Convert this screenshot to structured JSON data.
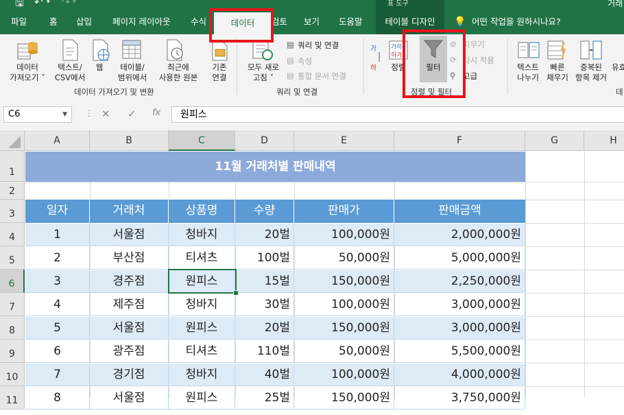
{
  "window": {
    "title_partial": "거래",
    "context_label_partial": "표 도구"
  },
  "tabs": [
    {
      "label": "파일"
    },
    {
      "label": "홈"
    },
    {
      "label": "삽입"
    },
    {
      "label": "페이지 레이아웃"
    },
    {
      "label": "수식"
    },
    {
      "label": "데이터"
    },
    {
      "label": "검토"
    },
    {
      "label": "보기"
    },
    {
      "label": "도움말"
    },
    {
      "label": "테이블 디자인"
    }
  ],
  "tell_me": "어떤 작업을 원하시나요?",
  "ribbon": {
    "get_data": "데이터\n가져오기 ˅",
    "text_csv": "텍스트/\nCSV에서",
    "web": "웹",
    "table_range": "테이블/\n범위에서",
    "recent_sources": "최근에\n사용한 원본",
    "existing_conn": "기존\n연결",
    "refresh_all": "모두 새로\n고침 ˅",
    "queries_conn": "쿼리 및 연결",
    "properties": "속성",
    "edit_links": "통합 문서 연결",
    "sort": "정렬",
    "filter": "필터",
    "clear": "지우기",
    "reapply": "다시 적용",
    "advanced": "고급",
    "text_to_columns": "텍스트\n나누기",
    "flash_fill": "빠른\n채우기",
    "remove_duplicates": "중복된\n항목 제거",
    "data_validation_partial": "유효",
    "group_get_transform": "데이터 가져오기 및 변환",
    "group_queries": "쿼리 및 연결",
    "group_sort_filter": "정렬 및 필터",
    "group_partial": "데"
  },
  "formula_bar": {
    "name_box": "C6",
    "formula": "원피스",
    "fx": "fx"
  },
  "columns": [
    "A",
    "B",
    "C",
    "D",
    "E",
    "F",
    "G",
    "H"
  ],
  "rows": [
    "1",
    "2",
    "3",
    "4",
    "5",
    "6",
    "7",
    "8",
    "9",
    "10",
    "11"
  ],
  "sheet": {
    "title": "11월 거래처별 판매내역",
    "headers": [
      "일자",
      "거래처",
      "상품명",
      "수량",
      "판매가",
      "판매금액"
    ],
    "data": [
      [
        "1",
        "서울점",
        "청바지",
        "20벌",
        "100,000원",
        "2,000,000원"
      ],
      [
        "2",
        "부산점",
        "티셔츠",
        "100벌",
        "50,000원",
        "5,000,000원"
      ],
      [
        "3",
        "경주점",
        "원피스",
        "15벌",
        "150,000원",
        "2,250,000원"
      ],
      [
        "4",
        "제주점",
        "청바지",
        "30벌",
        "100,000원",
        "3,000,000원"
      ],
      [
        "5",
        "서울점",
        "원피스",
        "20벌",
        "150,000원",
        "3,000,000원"
      ],
      [
        "6",
        "광주점",
        "티셔츠",
        "110벌",
        "50,000원",
        "5,500,000원"
      ],
      [
        "7",
        "경기점",
        "청바지",
        "40벌",
        "100,000원",
        "4,000,000원"
      ],
      [
        "8",
        "서울점",
        "원피스",
        "25벌",
        "150,000원",
        "3,750,000원"
      ]
    ]
  },
  "colors": {
    "accent": "#217346",
    "header_fill": "#5b9bd5",
    "title_fill": "#8eaadb",
    "band_fill": "#ddebf7",
    "highlight": "#e8141b"
  }
}
